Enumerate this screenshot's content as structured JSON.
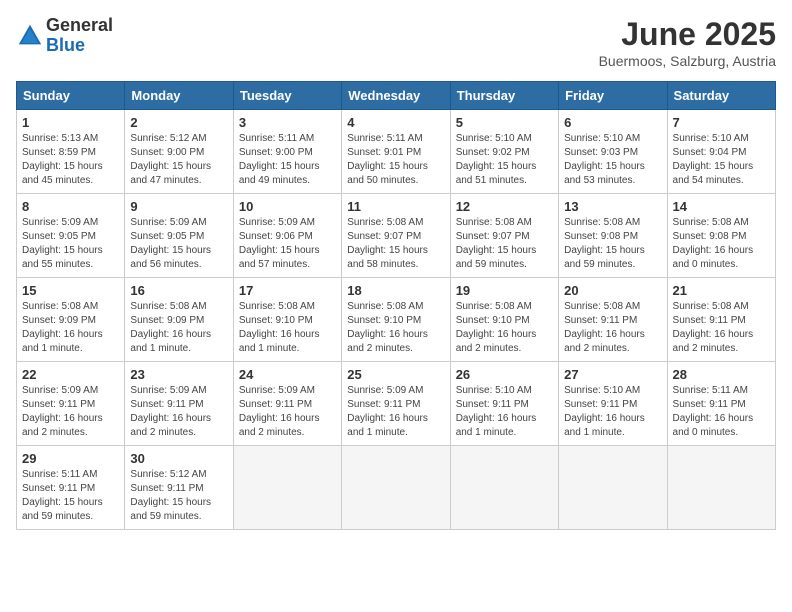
{
  "header": {
    "logo_general": "General",
    "logo_blue": "Blue",
    "month_title": "June 2025",
    "location": "Buermoos, Salzburg, Austria"
  },
  "weekdays": [
    "Sunday",
    "Monday",
    "Tuesday",
    "Wednesday",
    "Thursday",
    "Friday",
    "Saturday"
  ],
  "days": [
    {
      "day": "",
      "info": ""
    },
    {
      "day": "",
      "info": ""
    },
    {
      "day": "",
      "info": ""
    },
    {
      "day": "",
      "info": ""
    },
    {
      "day": "",
      "info": ""
    },
    {
      "day": "",
      "info": ""
    },
    {
      "day": "7",
      "sunrise": "5:10 AM",
      "sunset": "9:04 PM",
      "daylight": "15 hours and 54 minutes."
    },
    {
      "day": "1",
      "sunrise": "5:13 AM",
      "sunset": "8:59 PM",
      "daylight": "15 hours and 45 minutes."
    },
    {
      "day": "2",
      "sunrise": "5:12 AM",
      "sunset": "9:00 PM",
      "daylight": "15 hours and 47 minutes."
    },
    {
      "day": "3",
      "sunrise": "5:11 AM",
      "sunset": "9:00 PM",
      "daylight": "15 hours and 49 minutes."
    },
    {
      "day": "4",
      "sunrise": "5:11 AM",
      "sunset": "9:01 PM",
      "daylight": "15 hours and 50 minutes."
    },
    {
      "day": "5",
      "sunrise": "5:10 AM",
      "sunset": "9:02 PM",
      "daylight": "15 hours and 51 minutes."
    },
    {
      "day": "6",
      "sunrise": "5:10 AM",
      "sunset": "9:03 PM",
      "daylight": "15 hours and 53 minutes."
    },
    {
      "day": "7",
      "sunrise": "5:10 AM",
      "sunset": "9:04 PM",
      "daylight": "15 hours and 54 minutes."
    },
    {
      "day": "8",
      "sunrise": "5:09 AM",
      "sunset": "9:05 PM",
      "daylight": "15 hours and 55 minutes."
    },
    {
      "day": "9",
      "sunrise": "5:09 AM",
      "sunset": "9:05 PM",
      "daylight": "15 hours and 56 minutes."
    },
    {
      "day": "10",
      "sunrise": "5:09 AM",
      "sunset": "9:06 PM",
      "daylight": "15 hours and 57 minutes."
    },
    {
      "day": "11",
      "sunrise": "5:08 AM",
      "sunset": "9:07 PM",
      "daylight": "15 hours and 58 minutes."
    },
    {
      "day": "12",
      "sunrise": "5:08 AM",
      "sunset": "9:07 PM",
      "daylight": "15 hours and 59 minutes."
    },
    {
      "day": "13",
      "sunrise": "5:08 AM",
      "sunset": "9:08 PM",
      "daylight": "15 hours and 59 minutes."
    },
    {
      "day": "14",
      "sunrise": "5:08 AM",
      "sunset": "9:08 PM",
      "daylight": "16 hours and 0 minutes."
    },
    {
      "day": "15",
      "sunrise": "5:08 AM",
      "sunset": "9:09 PM",
      "daylight": "16 hours and 1 minute."
    },
    {
      "day": "16",
      "sunrise": "5:08 AM",
      "sunset": "9:09 PM",
      "daylight": "16 hours and 1 minute."
    },
    {
      "day": "17",
      "sunrise": "5:08 AM",
      "sunset": "9:10 PM",
      "daylight": "16 hours and 1 minute."
    },
    {
      "day": "18",
      "sunrise": "5:08 AM",
      "sunset": "9:10 PM",
      "daylight": "16 hours and 2 minutes."
    },
    {
      "day": "19",
      "sunrise": "5:08 AM",
      "sunset": "9:10 PM",
      "daylight": "16 hours and 2 minutes."
    },
    {
      "day": "20",
      "sunrise": "5:08 AM",
      "sunset": "9:11 PM",
      "daylight": "16 hours and 2 minutes."
    },
    {
      "day": "21",
      "sunrise": "5:08 AM",
      "sunset": "9:11 PM",
      "daylight": "16 hours and 2 minutes."
    },
    {
      "day": "22",
      "sunrise": "5:09 AM",
      "sunset": "9:11 PM",
      "daylight": "16 hours and 2 minutes."
    },
    {
      "day": "23",
      "sunrise": "5:09 AM",
      "sunset": "9:11 PM",
      "daylight": "16 hours and 2 minutes."
    },
    {
      "day": "24",
      "sunrise": "5:09 AM",
      "sunset": "9:11 PM",
      "daylight": "16 hours and 2 minutes."
    },
    {
      "day": "25",
      "sunrise": "5:09 AM",
      "sunset": "9:11 PM",
      "daylight": "16 hours and 1 minute."
    },
    {
      "day": "26",
      "sunrise": "5:10 AM",
      "sunset": "9:11 PM",
      "daylight": "16 hours and 1 minute."
    },
    {
      "day": "27",
      "sunrise": "5:10 AM",
      "sunset": "9:11 PM",
      "daylight": "16 hours and 1 minute."
    },
    {
      "day": "28",
      "sunrise": "5:11 AM",
      "sunset": "9:11 PM",
      "daylight": "16 hours and 0 minutes."
    },
    {
      "day": "29",
      "sunrise": "5:11 AM",
      "sunset": "9:11 PM",
      "daylight": "15 hours and 59 minutes."
    },
    {
      "day": "30",
      "sunrise": "5:12 AM",
      "sunset": "9:11 PM",
      "daylight": "15 hours and 59 minutes."
    }
  ]
}
